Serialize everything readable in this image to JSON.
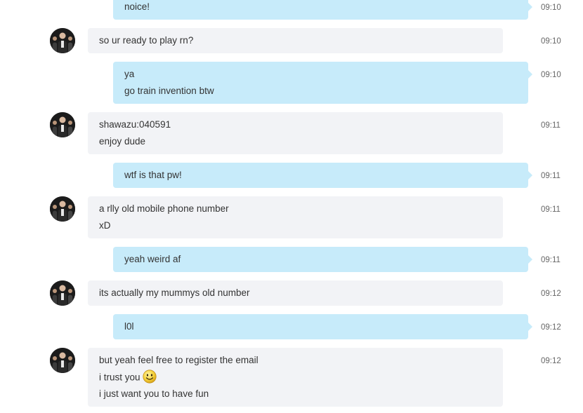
{
  "conversation": {
    "messages": [
      {
        "direction": "out",
        "lines": [
          "noice!"
        ],
        "time": "09:10"
      },
      {
        "direction": "in",
        "lines": [
          "so ur ready to play rn?"
        ],
        "time": "09:10"
      },
      {
        "direction": "out",
        "lines": [
          "ya",
          "go train invention btw"
        ],
        "time": "09:10"
      },
      {
        "direction": "in",
        "lines": [
          "shawazu:040591",
          "enjoy dude"
        ],
        "time": "09:11"
      },
      {
        "direction": "out",
        "lines": [
          "wtf is that pw!"
        ],
        "time": "09:11"
      },
      {
        "direction": "in",
        "lines": [
          "a rlly old mobile phone number",
          "xD"
        ],
        "time": "09:11"
      },
      {
        "direction": "out",
        "lines": [
          "yeah weird af"
        ],
        "time": "09:11"
      },
      {
        "direction": "in",
        "lines": [
          "its actually my mummys old number"
        ],
        "time": "09:12"
      },
      {
        "direction": "out",
        "lines": [
          "l0l"
        ],
        "time": "09:12"
      },
      {
        "direction": "in",
        "lines": [
          "but yeah feel free to register the email",
          "i trust you",
          "i just want you to have fun"
        ],
        "time": "09:12"
      }
    ],
    "emoji_icon": "smiley-emoji-icon",
    "avatar_icon": "contact-avatar-icon"
  },
  "colors": {
    "incoming_bubble": "#f2f3f6",
    "outgoing_bubble": "#c7ebfa",
    "text": "#333333",
    "timestamp": "#666666"
  }
}
